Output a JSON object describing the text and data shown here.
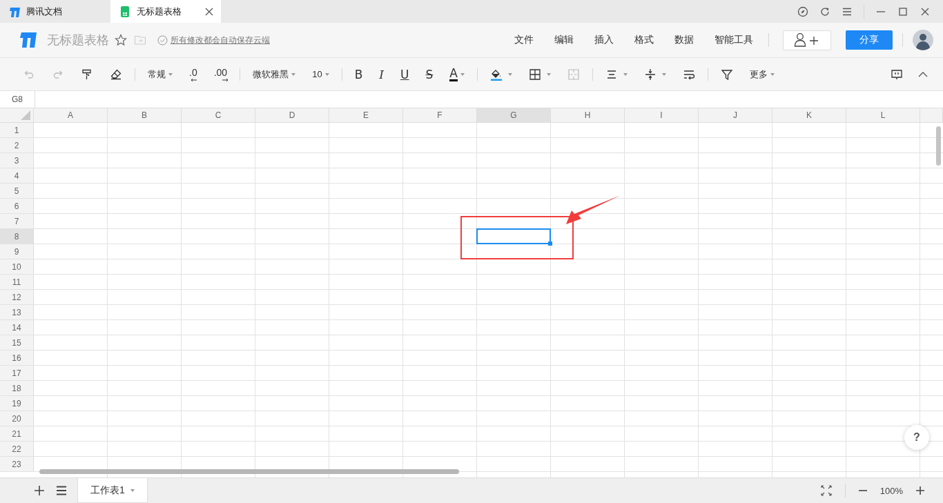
{
  "browser_tabs": [
    {
      "label": "腾讯文档",
      "selected": false,
      "kind": "docs"
    },
    {
      "label": "无标题表格",
      "selected": true,
      "kind": "sheet"
    }
  ],
  "header": {
    "title": "无标题表格",
    "save_status": "所有修改都会自动保存云端",
    "menus": [
      "文件",
      "编辑",
      "插入",
      "格式",
      "数据",
      "智能工具"
    ],
    "share": "分享"
  },
  "toolbar": {
    "groups": [
      [
        {
          "kind": "undo",
          "disabled": true
        },
        {
          "kind": "redo",
          "disabled": true
        },
        {
          "kind": "painter",
          "disabled": false
        },
        {
          "kind": "eraser",
          "disabled": false
        }
      ],
      [
        {
          "kind": "select",
          "label": "常规"
        },
        {
          "kind": "decless",
          "label": ".0"
        },
        {
          "kind": "decmore",
          "label": ".00"
        }
      ],
      [
        {
          "kind": "select",
          "label": "微软雅黑"
        },
        {
          "kind": "select",
          "label": "10"
        }
      ],
      [
        {
          "kind": "bold",
          "label": "B"
        },
        {
          "kind": "italic",
          "label": "I"
        },
        {
          "kind": "underline",
          "label": "U"
        },
        {
          "kind": "strike",
          "label": "S"
        },
        {
          "kind": "textcolor",
          "label": "A"
        }
      ],
      [
        {
          "kind": "fill",
          "disabled": false
        },
        {
          "kind": "borders",
          "disabled": false
        },
        {
          "kind": "merge",
          "disabled": true
        }
      ],
      [
        {
          "kind": "halign",
          "disabled": false
        },
        {
          "kind": "valign",
          "disabled": false
        },
        {
          "kind": "wrap",
          "disabled": false
        }
      ],
      [
        {
          "kind": "filter",
          "disabled": false
        },
        {
          "kind": "select",
          "label": "更多"
        }
      ]
    ]
  },
  "name_box": "G8",
  "columns": [
    {
      "label": "A",
      "selected": false
    },
    {
      "label": "B",
      "selected": false
    },
    {
      "label": "C",
      "selected": false
    },
    {
      "label": "D",
      "selected": false
    },
    {
      "label": "E",
      "selected": false
    },
    {
      "label": "F",
      "selected": false
    },
    {
      "label": "G",
      "selected": true
    },
    {
      "label": "H",
      "selected": false
    },
    {
      "label": "I",
      "selected": false
    },
    {
      "label": "J",
      "selected": false
    },
    {
      "label": "K",
      "selected": false
    },
    {
      "label": "L",
      "selected": false
    }
  ],
  "rows": [
    {
      "label": "1",
      "selected": false
    },
    {
      "label": "2",
      "selected": false
    },
    {
      "label": "3",
      "selected": false
    },
    {
      "label": "4",
      "selected": false
    },
    {
      "label": "5",
      "selected": false
    },
    {
      "label": "6",
      "selected": false
    },
    {
      "label": "7",
      "selected": false
    },
    {
      "label": "8",
      "selected": true
    },
    {
      "label": "9",
      "selected": false
    },
    {
      "label": "10",
      "selected": false
    },
    {
      "label": "11",
      "selected": false
    },
    {
      "label": "12",
      "selected": false
    },
    {
      "label": "13",
      "selected": false
    },
    {
      "label": "14",
      "selected": false
    },
    {
      "label": "15",
      "selected": false
    },
    {
      "label": "16",
      "selected": false
    },
    {
      "label": "17",
      "selected": false
    },
    {
      "label": "18",
      "selected": false
    },
    {
      "label": "19",
      "selected": false
    },
    {
      "label": "20",
      "selected": false
    },
    {
      "label": "21",
      "selected": false
    },
    {
      "label": "22",
      "selected": false
    },
    {
      "label": "23",
      "selected": false
    }
  ],
  "help": "?",
  "sheets": [
    {
      "label": "工作表1",
      "selected": true
    }
  ],
  "zoom": "100%"
}
